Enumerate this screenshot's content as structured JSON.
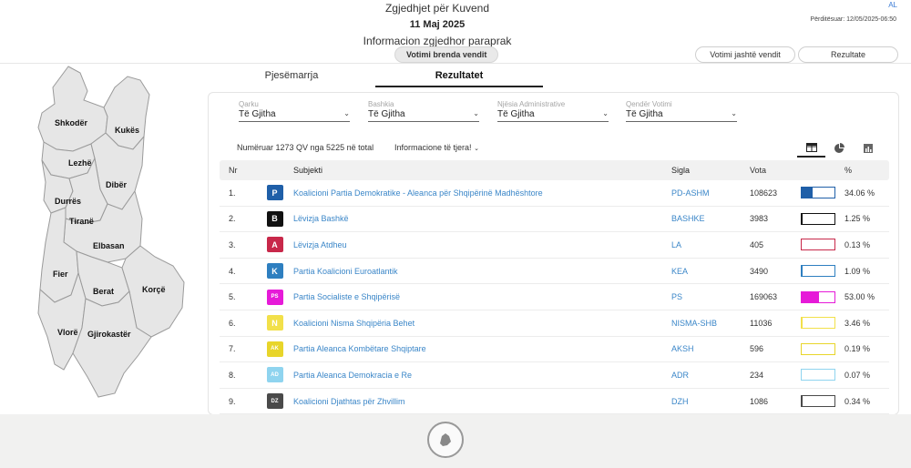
{
  "header": {
    "title": "Zgjedhjet për Kuvend",
    "date": "11 Maj 2025",
    "subtitle": "Informacion zgjedhor paraprak",
    "lang": "AL",
    "updated": "Përditësuar: 12/05/2025-06:50",
    "btn_inside": "Votimi brenda vendit",
    "btn_abroad": "Votimi jashtë vendit",
    "btn_results": "Rezultate"
  },
  "map": {
    "regions": [
      "Shkodër",
      "Kukës",
      "Lezhë",
      "Dibër",
      "Durrës",
      "Tiranë",
      "Elbasan",
      "Fier",
      "Berat",
      "Korçë",
      "Vlorë",
      "Gjirokastër"
    ]
  },
  "tabs": {
    "participation": "Pjesëmarrja",
    "results": "Rezultatet"
  },
  "filters": [
    {
      "label": "Qarku",
      "value": "Të Gjitha"
    },
    {
      "label": "Bashkia",
      "value": "Të Gjitha"
    },
    {
      "label": "Njësia Administrative",
      "value": "Të Gjitha"
    },
    {
      "label": "Qendër Votimi",
      "value": "Të Gjitha"
    }
  ],
  "counted_text": "Numëruar 1273 QV nga 5225 në total",
  "more_info": "Informacione të tjera!",
  "table": {
    "headers": {
      "nr": "Nr",
      "subject": "Subjekti",
      "sigla": "Sigla",
      "votes": "Vota",
      "pct": "%"
    },
    "rows": [
      {
        "nr": "1.",
        "subject": "Koalicioni Partia Demokratike - Aleanca për Shqipërinë Madhështore",
        "sigla": "PD-ASHM",
        "votes": "108623",
        "pct": "34.06 %",
        "share": 0.3406,
        "color": "#1f5fa8",
        "logo": "P"
      },
      {
        "nr": "2.",
        "subject": "Lëvizja Bashkë",
        "sigla": "BASHKE",
        "votes": "3983",
        "pct": "1.25 %",
        "share": 0.0125,
        "color": "#111111",
        "logo": "B"
      },
      {
        "nr": "3.",
        "subject": "Lëvizja Atdheu",
        "sigla": "LA",
        "votes": "405",
        "pct": "0.13 %",
        "share": 0.0013,
        "color": "#c8284a",
        "logo": "A"
      },
      {
        "nr": "4.",
        "subject": "Partia Koalicioni Euroatlantik",
        "sigla": "KEA",
        "votes": "3490",
        "pct": "1.09 %",
        "share": 0.0109,
        "color": "#2e7fc0",
        "logo": "K"
      },
      {
        "nr": "5.",
        "subject": "Partia Socialiste e Shqipërisë",
        "sigla": "PS",
        "votes": "169063",
        "pct": "53.00 %",
        "share": 0.53,
        "color": "#e61ad8",
        "logo": "PS"
      },
      {
        "nr": "6.",
        "subject": "Koalicioni Nisma Shqipëria Behet",
        "sigla": "NISMA-SHB",
        "votes": "11036",
        "pct": "3.46 %",
        "share": 0.0346,
        "color": "#f2e04a",
        "logo": "N"
      },
      {
        "nr": "7.",
        "subject": "Partia Aleanca Kombëtare Shqiptare",
        "sigla": "AKSH",
        "votes": "596",
        "pct": "0.19 %",
        "share": 0.0019,
        "color": "#e8d52a",
        "logo": "AK"
      },
      {
        "nr": "8.",
        "subject": "Partia Aleanca Demokracia e Re",
        "sigla": "ADR",
        "votes": "234",
        "pct": "0.07 %",
        "share": 0.0007,
        "color": "#8fd4ef",
        "logo": "AD"
      },
      {
        "nr": "9.",
        "subject": "Koalicioni Djathtas për Zhvillim",
        "sigla": "DZH",
        "votes": "1086",
        "pct": "0.34 %",
        "share": 0.0034,
        "color": "#4a4a4a",
        "logo": "DZ"
      }
    ]
  }
}
